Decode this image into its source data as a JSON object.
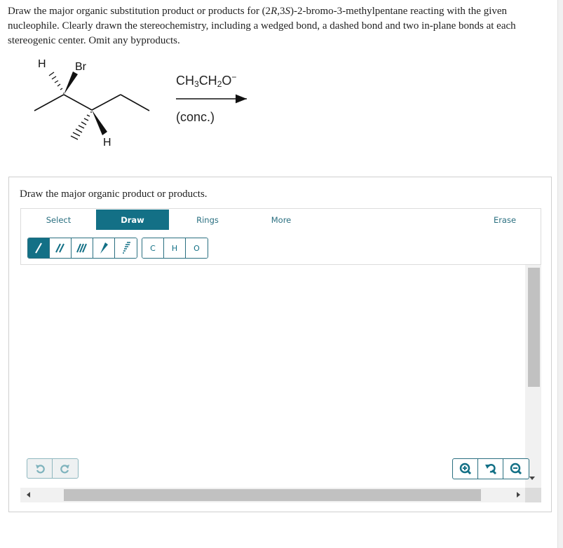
{
  "question": {
    "part1": "Draw the major organic substitution product or products for (2",
    "r": "R",
    "part2": ",3",
    "s": "S",
    "part3": ")-2-bromo-3-methylpentane reacting with the given nucleophile. Clearly drawn the stereochemistry, including a wedged bond, a dashed bond and two in-plane bonds at each stereogenic center. Omit any byproducts."
  },
  "scheme": {
    "atoms": {
      "h_top": "H",
      "br": "Br",
      "h_bottom": "H"
    },
    "reagent": {
      "c1": "CH",
      "s1": "3",
      "c2": "CH",
      "s2": "2",
      "c3": "O",
      "charge": "−"
    },
    "condition": "(conc.)"
  },
  "panel": {
    "prompt": "Draw the major organic product or products.",
    "tabs": [
      {
        "label": "Select",
        "active": false
      },
      {
        "label": "Draw",
        "active": true
      },
      {
        "label": "Rings",
        "active": false
      },
      {
        "label": "More",
        "active": false
      },
      {
        "label": "Erase",
        "active": false
      }
    ],
    "bond_tools": [
      {
        "icon": "single-bond-icon",
        "active": true
      },
      {
        "icon": "double-bond-icon",
        "active": false
      },
      {
        "icon": "triple-bond-icon",
        "active": false
      },
      {
        "icon": "wedge-bond-icon",
        "active": false
      },
      {
        "icon": "dash-bond-icon",
        "active": false
      }
    ],
    "atom_tools": [
      "C",
      "H",
      "O"
    ],
    "history": [
      "undo-icon",
      "redo-icon"
    ],
    "zoom": [
      "zoom-in-icon",
      "zoom-reset-icon",
      "zoom-out-icon"
    ]
  },
  "colors": {
    "accent": "#137086",
    "accent_text": "#2a6f80"
  }
}
